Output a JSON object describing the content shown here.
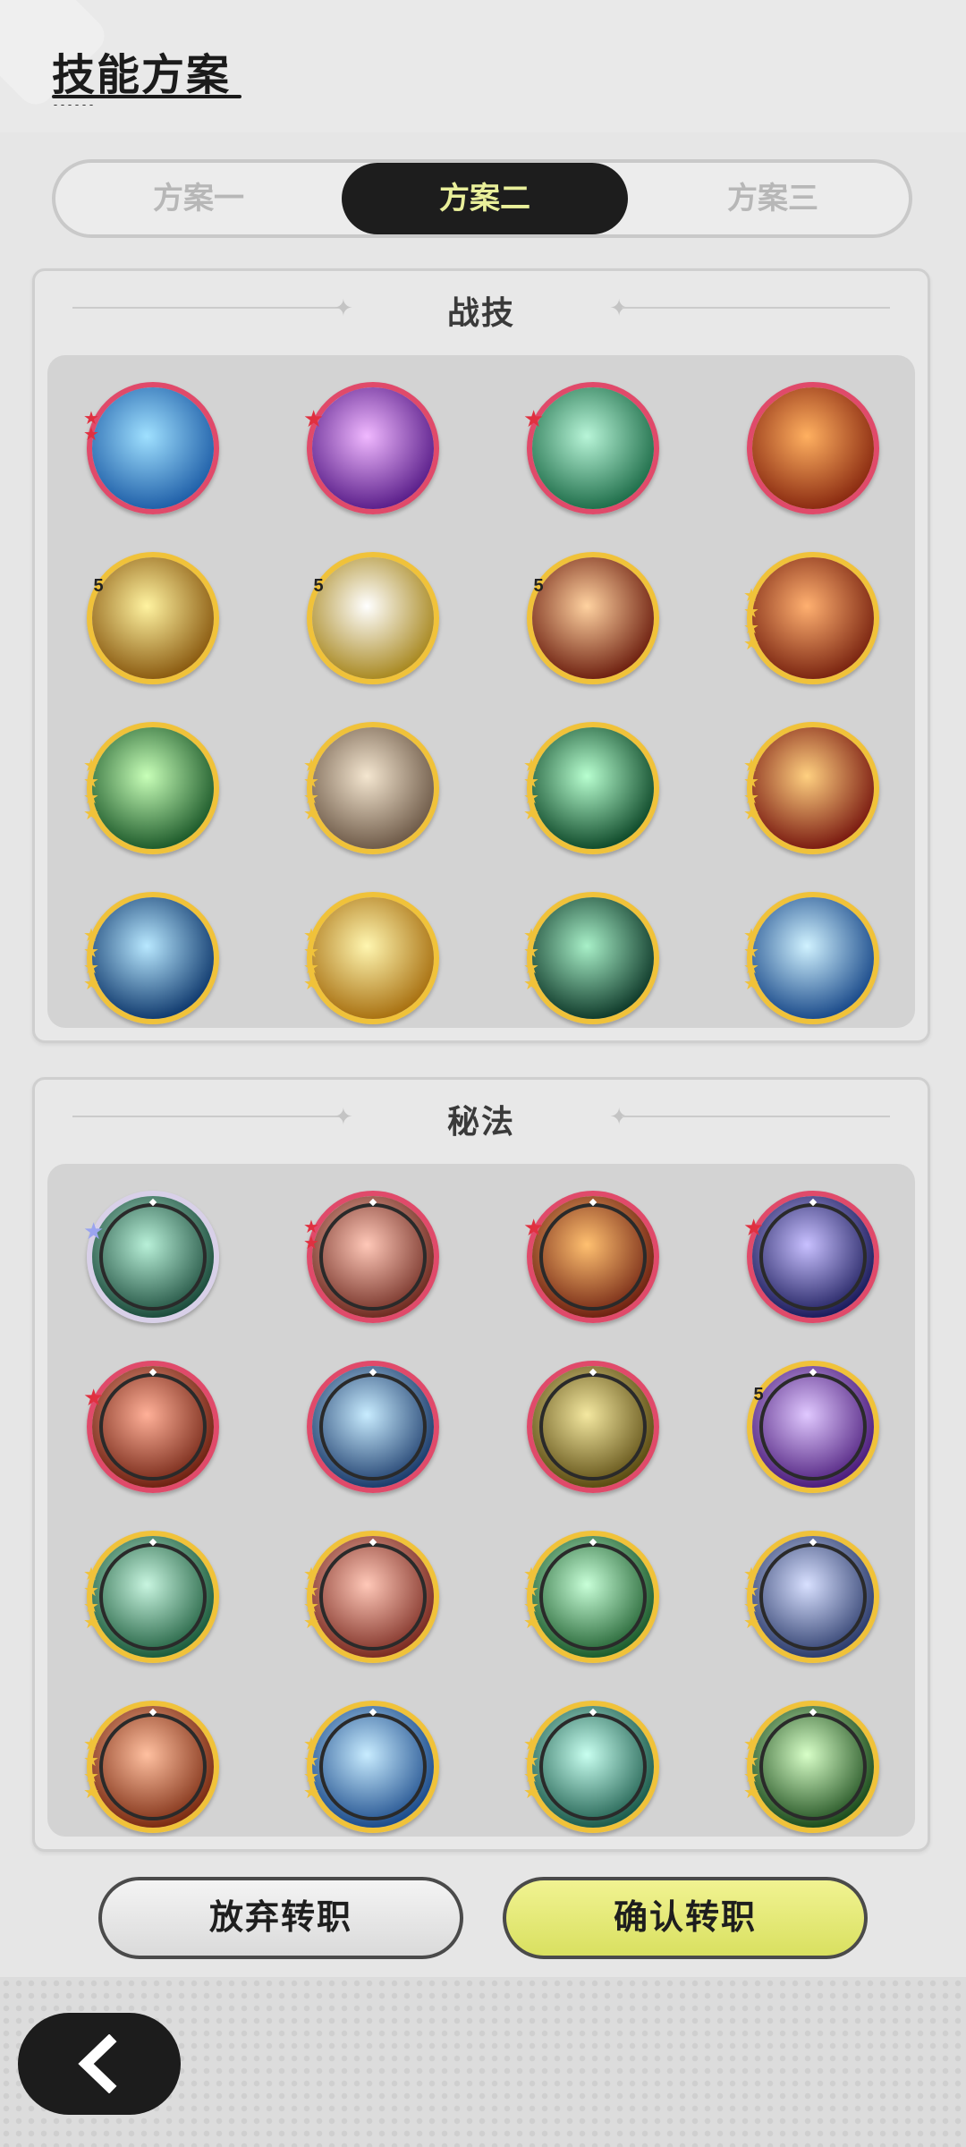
{
  "header": {
    "title": "技能方案"
  },
  "tabs": [
    {
      "label": "方案一",
      "active": false
    },
    {
      "label": "方案二",
      "active": true
    },
    {
      "label": "方案三",
      "active": false
    }
  ],
  "sections": {
    "combat": {
      "title": "战技",
      "skills": [
        {
          "name": "water-wave-skill-icon",
          "frame": "red",
          "badge": "red-star-2"
        },
        {
          "name": "purple-lightning-skill-icon",
          "frame": "red",
          "badge": "red-star"
        },
        {
          "name": "green-whirlwind-skill-icon",
          "frame": "red",
          "badge": "red-star"
        },
        {
          "name": "fire-explosion-skill-icon",
          "frame": "red",
          "badge": ""
        },
        {
          "name": "golden-burst-skill-icon",
          "frame": "gold",
          "badge": "5"
        },
        {
          "name": "light-orb-skill-icon",
          "frame": "gold",
          "badge": "5"
        },
        {
          "name": "meteor-skill-icon",
          "frame": "gold",
          "badge": "5"
        },
        {
          "name": "flame-wave-skill-icon",
          "frame": "gold",
          "badge": "stars"
        },
        {
          "name": "green-leaf-skill-icon",
          "frame": "gold",
          "badge": "stars"
        },
        {
          "name": "stone-shards-skill-icon",
          "frame": "gold",
          "badge": "stars"
        },
        {
          "name": "healing-cross-skill-icon",
          "frame": "gold",
          "badge": "stars"
        },
        {
          "name": "fireball-skill-icon",
          "frame": "gold",
          "badge": "stars"
        },
        {
          "name": "blue-flame-skill-icon",
          "frame": "gold",
          "badge": "stars"
        },
        {
          "name": "light-strike-skill-icon",
          "frame": "gold",
          "badge": "stars"
        },
        {
          "name": "thorn-vine-skill-icon",
          "frame": "gold",
          "badge": "stars"
        },
        {
          "name": "ice-crystal-skill-icon",
          "frame": "gold",
          "badge": "stars"
        }
      ]
    },
    "secret": {
      "title": "秘法",
      "skills": [
        {
          "name": "green-thorn-secret-icon",
          "frame": "rainbow",
          "badge": "silver-star"
        },
        {
          "name": "heal-figure-secret-icon",
          "frame": "red",
          "badge": "red-star-2"
        },
        {
          "name": "fire-orb-secret-icon",
          "frame": "red",
          "badge": "red-star"
        },
        {
          "name": "clock-portal-secret-icon",
          "frame": "red",
          "badge": "red-star"
        },
        {
          "name": "demon-mask-secret-icon",
          "frame": "red",
          "badge": "red-star"
        },
        {
          "name": "ice-crystal-secret-icon",
          "frame": "red",
          "badge": ""
        },
        {
          "name": "gold-shield-secret-icon",
          "frame": "red",
          "badge": ""
        },
        {
          "name": "purple-swirl-secret-icon",
          "frame": "gold",
          "badge": "5"
        },
        {
          "name": "green-shield-secret-icon",
          "frame": "gold",
          "badge": "stars"
        },
        {
          "name": "red-swirl-secret-icon",
          "frame": "gold",
          "badge": "stars"
        },
        {
          "name": "green-heart-secret-icon",
          "frame": "gold",
          "badge": "stars"
        },
        {
          "name": "armor-secret-icon",
          "frame": "gold",
          "badge": "stars"
        },
        {
          "name": "fire-figure-secret-icon",
          "frame": "gold",
          "badge": "stars"
        },
        {
          "name": "water-figure-secret-icon",
          "frame": "gold",
          "badge": "stars"
        },
        {
          "name": "wind-figure-secret-icon",
          "frame": "gold",
          "badge": "stars"
        },
        {
          "name": "green-spike-secret-icon",
          "frame": "gold",
          "badge": "stars"
        }
      ]
    }
  },
  "buttons": {
    "abandon": "放弃转职",
    "confirm": "确认转职"
  },
  "colors": {
    "accent_text": "#e9ef9a",
    "confirm_bg": "#d9e060",
    "red_frame": "#e04a6a",
    "gold_frame": "#f0c23a"
  }
}
